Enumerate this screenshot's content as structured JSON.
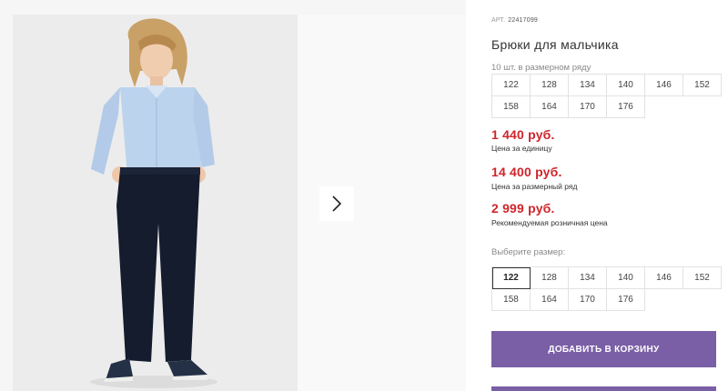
{
  "gallery": {
    "photo_icon": "child-model-photo",
    "next_icon": "chevron-right-icon"
  },
  "product": {
    "sku_label": "АРТ.",
    "sku": "22417099",
    "title": "Брюки для мальчика",
    "pack_info": "10 шт. в размерном ряду",
    "pack_sizes": [
      "122",
      "128",
      "134",
      "140",
      "146",
      "152",
      "158",
      "164",
      "170",
      "176"
    ]
  },
  "prices": {
    "unit_price": "1 440 руб.",
    "unit_note": "Цена за единицу",
    "pack_price": "14 400 руб.",
    "pack_note": "Цена за размерный ряд",
    "retail_price": "2 999 руб.",
    "retail_note": "Рекомендуемая розничная цена",
    "price_color": "#d0242b"
  },
  "size_select": {
    "label": "Выберите размер:",
    "selected": "122",
    "sizes": [
      "122",
      "128",
      "134",
      "140",
      "146",
      "152",
      "158",
      "164",
      "170",
      "176"
    ]
  },
  "cart": {
    "add_label": "ДОБАВИТЬ В КОРЗИНУ",
    "accent_color": "#7a5fa6"
  }
}
